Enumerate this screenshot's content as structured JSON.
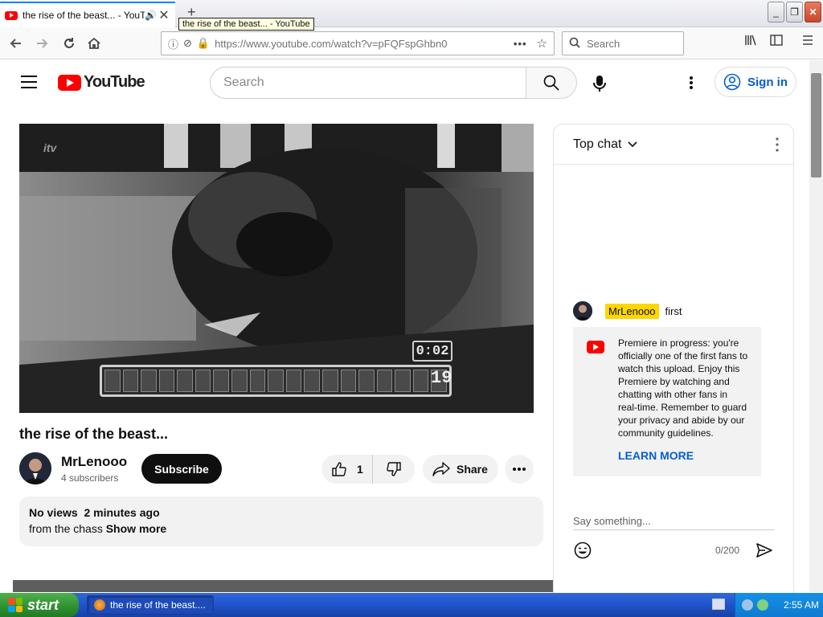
{
  "browser": {
    "tab_title": "the rise of the beast... - YouTube",
    "tooltip": "the rise of the beast... - YouTube",
    "url": "https://www.youtube.com/watch?v=pFQFspGhbn0",
    "search_placeholder": "Search",
    "url_dots": "•••"
  },
  "youtube": {
    "logo_text": "YouTube",
    "search_placeholder": "Search",
    "sign_in": "Sign in"
  },
  "video": {
    "title": "the rise of the beast...",
    "overlay_timer": "0:02",
    "overlay_number": "19",
    "overlay_logo": "itv",
    "channel": "MrLenooo",
    "subscribers": "4 subscribers",
    "subscribe": "Subscribe",
    "likes": "1",
    "share": "Share",
    "description": {
      "views": "No views",
      "time": "2 minutes ago",
      "text": "from the chass",
      "show_more": "Show more"
    }
  },
  "chat": {
    "header": "Top chat",
    "message": {
      "author": "MrLenooo",
      "text": "first"
    },
    "notice": "Premiere in progress: you're officially one of the first fans to watch this upload. Enjoy this Premiere by watching and chatting with other fans in real-time. Remember to guard your privacy and abide by our community guidelines.",
    "learn_more": "LEARN MORE",
    "input_placeholder": "Say something...",
    "counter": "0/200"
  },
  "taskbar": {
    "start": "start",
    "window": "the rise of the beast....",
    "clock": "2:55 AM"
  },
  "colors": {
    "youtube_red": "#ff0000",
    "link_blue": "#065fd4",
    "author_highlight": "#ffd600",
    "firefox_tab_accent": "#0a84ff",
    "xp_taskbar": "#2157d1",
    "xp_start": "#2f8f2f"
  },
  "icons": {
    "tab": [
      "youtube-favicon",
      "speaker-icon",
      "close-icon",
      "plus-icon"
    ],
    "nav": [
      "back-arrow-icon",
      "forward-arrow-icon",
      "reload-icon",
      "home-icon",
      "info-icon",
      "tracking-icon",
      "lock-icon",
      "star-icon",
      "library-icon",
      "sidebar-icon",
      "menu-icon"
    ],
    "youtube": [
      "hamburger-icon",
      "search-icon",
      "mic-icon",
      "kebab-icon",
      "user-icon",
      "thumb-up-icon",
      "thumb-down-icon",
      "share-icon",
      "more-icon"
    ],
    "chat": [
      "chevron-down-icon",
      "kebab-icon",
      "emoji-icon",
      "send-icon"
    ]
  }
}
